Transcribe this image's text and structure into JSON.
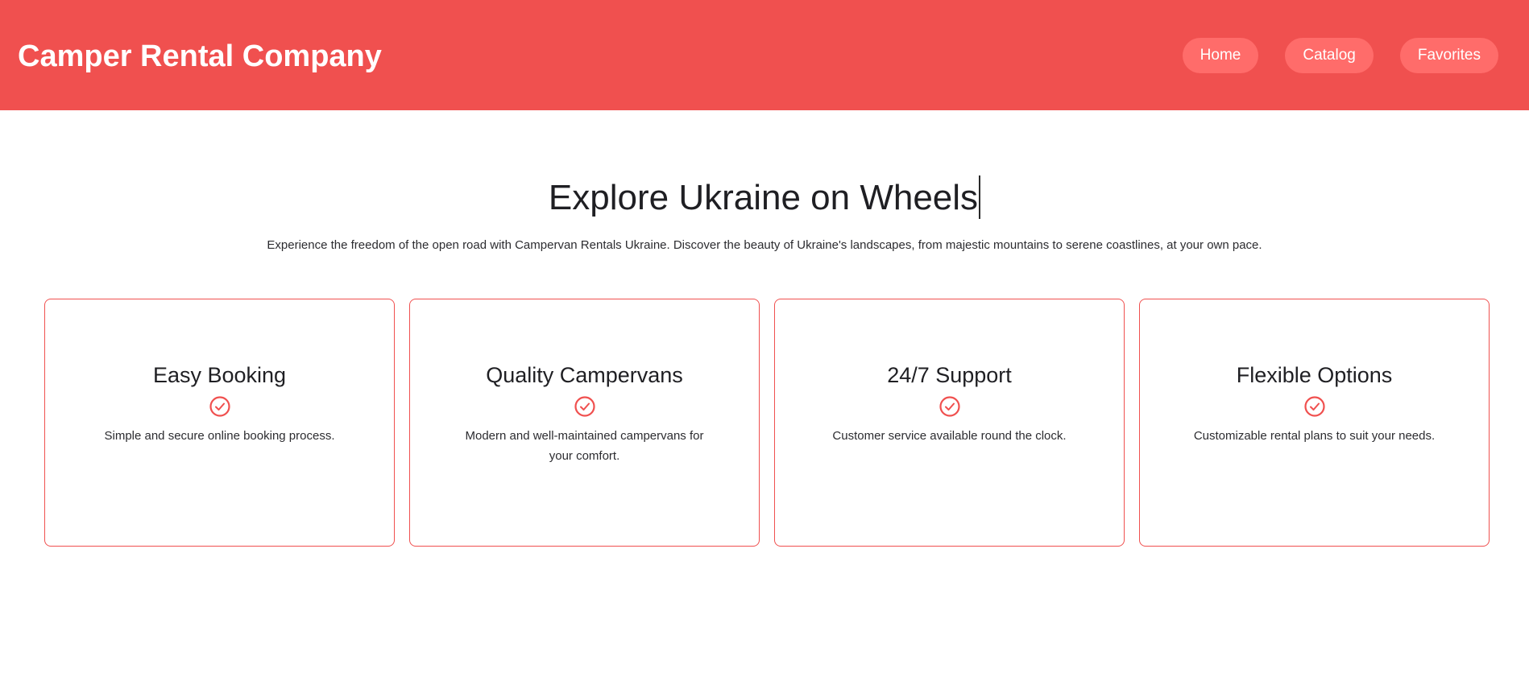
{
  "header": {
    "brand": "Camper Rental Company",
    "nav": [
      "Home",
      "Catalog",
      "Favorites"
    ]
  },
  "hero": {
    "title": "Explore Ukraine on Wheels",
    "text": "Experience the freedom of the open road with Campervan Rentals Ukraine. Discover the beauty of Ukraine's landscapes, from majestic mountains to serene coastlines, at your own pace."
  },
  "features": [
    {
      "title": "Easy Booking",
      "text": "Simple and secure online booking process.",
      "icon": "check-circle-icon"
    },
    {
      "title": "Quality Campervans",
      "text": "Modern and well-maintained campervans for your comfort.",
      "icon": "check-circle-icon"
    },
    {
      "title": "24/7 Support",
      "text": "Customer service available round the clock.",
      "icon": "check-circle-icon"
    },
    {
      "title": "Flexible Options",
      "text": "Customizable rental plans to suit your needs.",
      "icon": "check-circle-icon"
    }
  ],
  "colors": {
    "brand": "#f0504f",
    "nav_button": "#ff6c6a",
    "text": "#1f1f23"
  }
}
